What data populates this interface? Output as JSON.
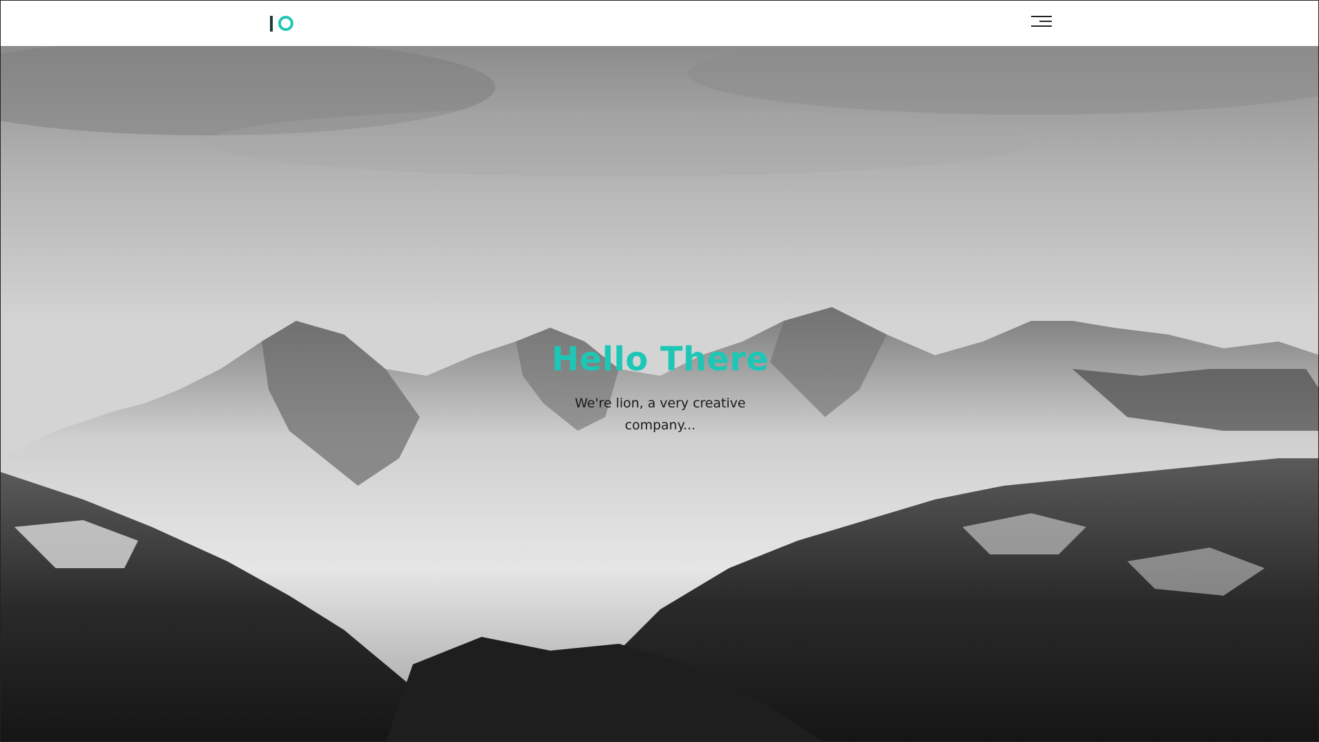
{
  "header": {
    "logo_name": "logo",
    "menu_icon": "hamburger-menu-icon"
  },
  "hero": {
    "title": "Hello There",
    "subtitle": "We're lion, a very creative company..."
  },
  "colors": {
    "accent": "#1ec6b6",
    "logo_bar": "#1f3a3a",
    "text": "#1a1a1a",
    "header_bg": "#ffffff"
  }
}
